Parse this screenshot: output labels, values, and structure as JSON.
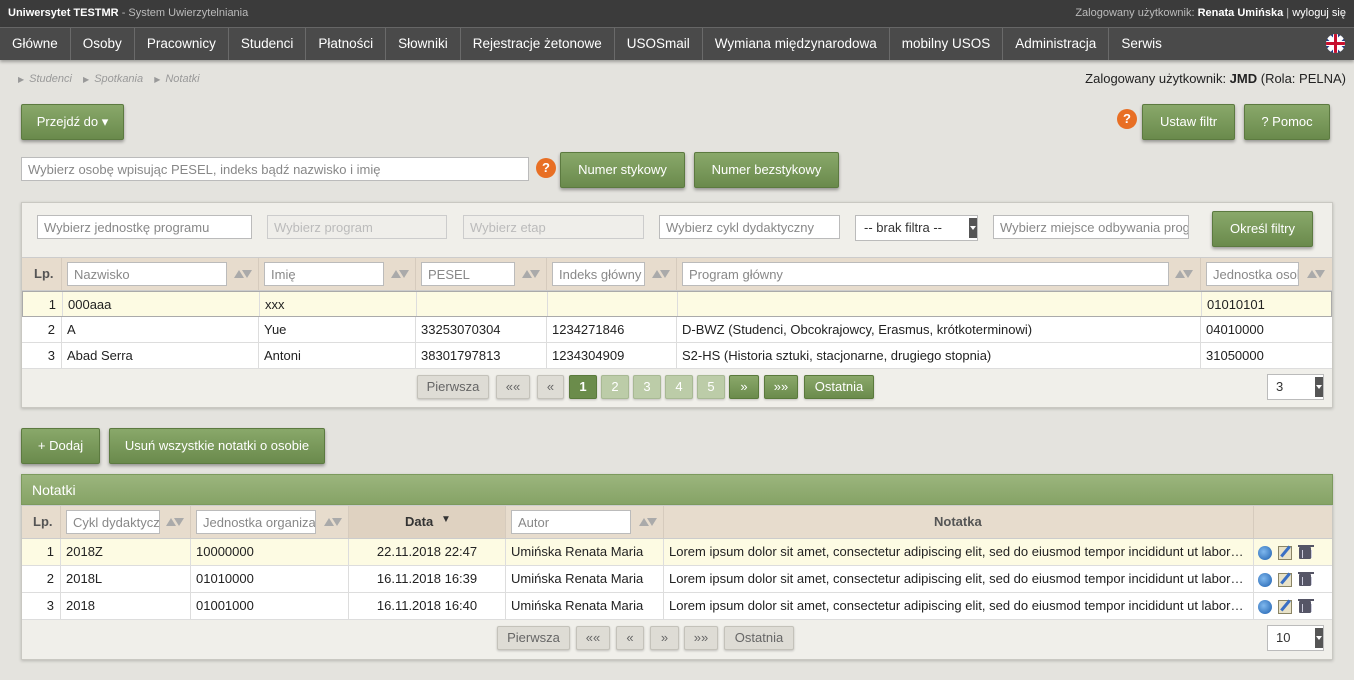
{
  "topbar": {
    "university": "Uniwersytet TESTMR",
    "system": " - System Uwierzytelniania",
    "logged_prefix": "Zalogowany użytkownik: ",
    "user": "Renata Umińska",
    "sep": " | ",
    "logout": "wyloguj się"
  },
  "menu": [
    "Główne",
    "Osoby",
    "Pracownicy",
    "Studenci",
    "Płatności",
    "Słowniki",
    "Rejestracje żetonowe",
    "USOSmail",
    "Wymiana międzynarodowa",
    "mobilny USOS",
    "Administracja",
    "Serwis"
  ],
  "breadcrumbs": [
    "Studenci",
    "Spotkania",
    "Notatki"
  ],
  "login_info": {
    "prefix": "Zalogowany użytkownik: ",
    "user": "JMD",
    "role": " (Rola: PELNA)"
  },
  "buttons": {
    "goto": "Przejdź do ▾",
    "set_filter": "Ustaw filtr",
    "help": "? Pomoc",
    "stick_number": "Numer stykowy",
    "nonstick_number": "Numer bezstykowy",
    "define_filters": "Określ filtry",
    "add": "+ Dodaj",
    "remove_all": "Usuń wszystkie notatki o osobie"
  },
  "help_icon": "?",
  "person_search": {
    "placeholder": "Wybierz osobę wpisując PESEL, indeks bądź nazwisko i imię"
  },
  "filters": {
    "unit": "Wybierz jednostkę programu",
    "program": "Wybierz program",
    "stage": "Wybierz etap",
    "cycle": "Wybierz cykl dydaktyczny",
    "nofilter": "-- brak filtra --",
    "place": "Wybierz miejsce odbywania prog"
  },
  "students": {
    "lp_header": "Lp.",
    "col_filters": [
      "Nazwisko",
      "Imię",
      "PESEL",
      "Indeks główny",
      "Program główny",
      "Jednostka osoby"
    ],
    "rows": [
      {
        "lp": "1",
        "nazwisko": "000aaa",
        "imie": "xxx",
        "pesel": "",
        "indeks": "",
        "program": "",
        "jednostka": "01010101"
      },
      {
        "lp": "2",
        "nazwisko": "A",
        "imie": "Yue",
        "pesel": "33253070304",
        "indeks": "1234271846",
        "program": "D-BWZ (Studenci, Obcokrajowcy, Erasmus, krótkoterminowi)",
        "jednostka": "04010000"
      },
      {
        "lp": "3",
        "nazwisko": "Abad Serra",
        "imie": "Antoni",
        "pesel": "38301797813",
        "indeks": "1234304909",
        "program": "S2-HS (Historia sztuki, stacjonarne, drugiego stopnia)",
        "jednostka": "31050000"
      }
    ],
    "pager": {
      "first": "Pierwsza",
      "first_arrows": "««",
      "prev": "«",
      "pages": [
        "1",
        "2",
        "3",
        "4",
        "5"
      ],
      "current": "1",
      "next": "»",
      "next_arrows": "»»",
      "last": "Ostatnia",
      "per_page": "3"
    }
  },
  "notes": {
    "title": "Notatki",
    "lp_header": "Lp.",
    "col_filters": [
      "Cykl dydaktyczny",
      "Jednostka organizacyjna"
    ],
    "date_header": "Data",
    "author_filter": "Autor",
    "note_header": "Notatka",
    "rows": [
      {
        "lp": "1",
        "cykl": "2018Z",
        "jednostka": "10000000",
        "data": "22.11.2018 22:47",
        "autor": "Umińska Renata Maria",
        "notatka": "Lorem ipsum dolor sit amet, consectetur adipiscing elit, sed do eiusmod tempor incididunt ut labore et dolore magna aliqua."
      },
      {
        "lp": "2",
        "cykl": "2018L",
        "jednostka": "01010000",
        "data": "16.11.2018 16:39",
        "autor": "Umińska Renata Maria",
        "notatka": "Lorem ipsum dolor sit amet, consectetur adipiscing elit, sed do eiusmod tempor incididunt ut labore et dolore magna aliqua."
      },
      {
        "lp": "3",
        "cykl": "2018",
        "jednostka": "01001000",
        "data": "16.11.2018 16:40",
        "autor": "Umińska Renata Maria",
        "notatka": "Lorem ipsum dolor sit amet, consectetur adipiscing elit, sed do eiusmod tempor incididunt ut labore et dolore magna aliqua."
      }
    ],
    "pager": {
      "first": "Pierwsza",
      "first_arrows": "««",
      "prev": "«",
      "next": "»",
      "next_arrows": "»»",
      "last": "Ostatnia",
      "per_page": "10"
    }
  },
  "colors": {
    "accent": "#6b8c4b",
    "selected_row": "#fdfbe3",
    "header_bg": "#e7dccd",
    "help": "#e86f24"
  }
}
